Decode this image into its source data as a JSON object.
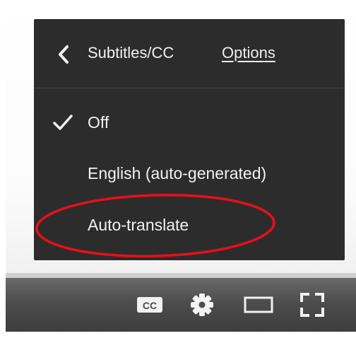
{
  "menu": {
    "title": "Subtitles/CC",
    "options_label": "Options",
    "items": [
      {
        "label": "Off",
        "selected": true
      },
      {
        "label": "English (auto-generated)",
        "selected": false
      },
      {
        "label": "Auto-translate",
        "selected": false
      }
    ]
  },
  "icons": {
    "back": "chevron-left-icon",
    "check": "checkmark-icon",
    "captions": "cc-icon",
    "settings": "gear-icon",
    "theater": "theater-mode-icon",
    "fullscreen": "fullscreen-icon"
  },
  "annotation": {
    "highlight_color": "#e8101a",
    "highlighted_item": "Auto-translate"
  },
  "colors": {
    "menu_bg": "#1c1c1c",
    "menu_text": "#eeeeee",
    "control_bar": "#4d4d4d"
  }
}
